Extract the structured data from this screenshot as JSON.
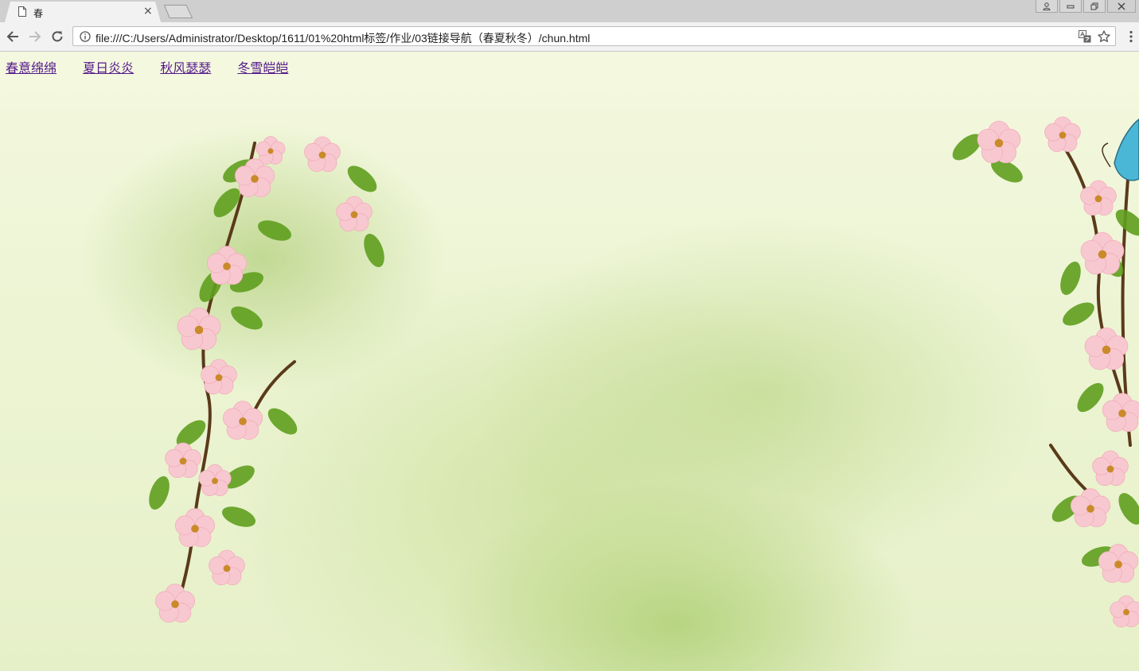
{
  "browser": {
    "tab": {
      "title": "春",
      "close_glyph": "×"
    },
    "address_bar": {
      "url": "file:///C:/Users/Administrator/Desktop/1611/01%20html标签/作业/03链接导航（春夏秋冬）/chun.html"
    },
    "icons": {
      "back": "arrow-left-icon",
      "forward": "arrow-right-icon",
      "reload": "reload-icon",
      "info": "info-icon",
      "translate": "translate-icon",
      "bookmark": "star-icon",
      "menu": "kebab-menu-icon"
    }
  },
  "page": {
    "nav_links": [
      {
        "label": "春意绵绵"
      },
      {
        "label": "夏日炎炎"
      },
      {
        "label": "秋风瑟瑟"
      },
      {
        "label": "冬雪皑皑"
      }
    ],
    "colors": {
      "link": "#551a8b",
      "background": "#eef5d6",
      "blossom": "#f7c6cf",
      "leaf": "#5f9e1e"
    }
  }
}
